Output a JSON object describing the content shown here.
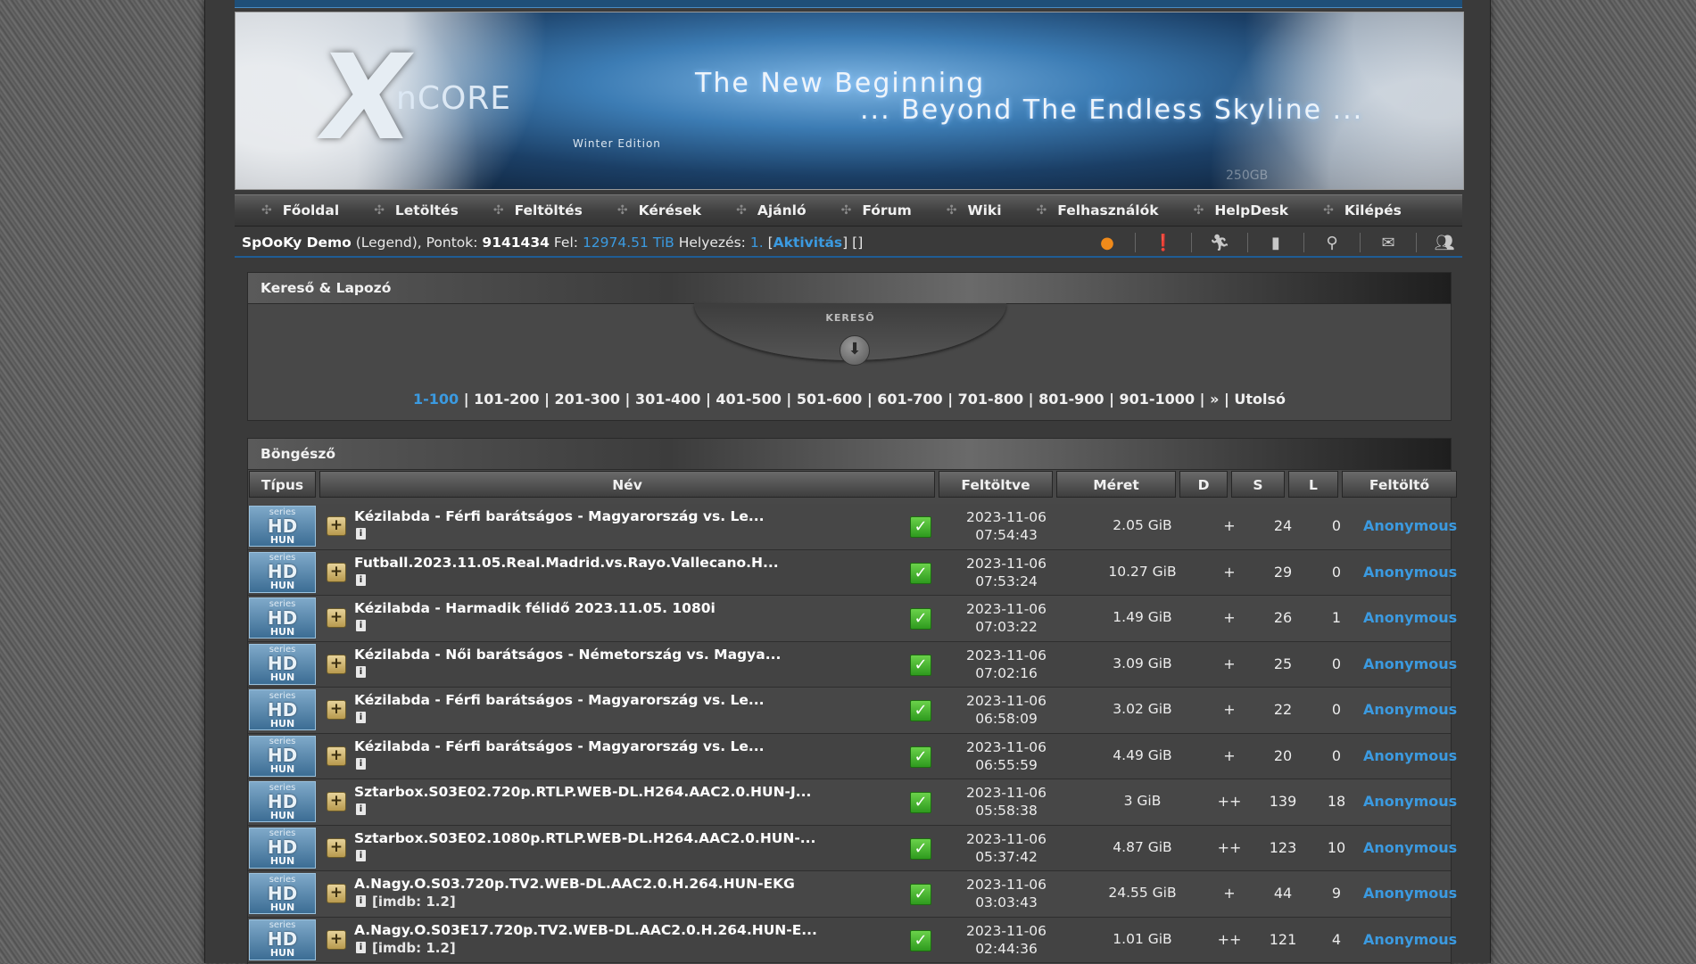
{
  "banner": {
    "logo_x": "X",
    "logo_rest": "nCORE",
    "edition": "Winter Edition",
    "tagline1": "The New Beginning",
    "tagline2": "... Beyond The Endless Skyline ...",
    "watermark": "250GB"
  },
  "nav": [
    {
      "label": "Főoldal"
    },
    {
      "label": "Letöltés"
    },
    {
      "label": "Feltöltés"
    },
    {
      "label": "Kérések"
    },
    {
      "label": "Ajánló"
    },
    {
      "label": "Fórum"
    },
    {
      "label": "Wiki"
    },
    {
      "label": "Felhasználók"
    },
    {
      "label": "HelpDesk"
    },
    {
      "label": "Kilépés"
    }
  ],
  "user": {
    "name": "SpOoKy Demo",
    "rank": "(Legend), Pontok:",
    "points": "9141434",
    "upload_label": "Fel:",
    "upload": "12974.51 TiB",
    "position_label": "Helyezés:",
    "position": "1.",
    "activity_open": "[",
    "activity": "Aktivitás",
    "activity_close": "] []"
  },
  "user_icons": [
    "pumpkin-icon",
    "alert-icon",
    "runner-icon",
    "bookmark-icon",
    "search-icon",
    "message-icon",
    "users-icon"
  ],
  "kereso": {
    "header": "Kereső & Lapozó",
    "tab_label": "KERESŐ",
    "arrow": "⬇"
  },
  "pager": [
    {
      "label": "1-100",
      "current": true
    },
    {
      "label": "101-200"
    },
    {
      "label": "201-300"
    },
    {
      "label": "301-400"
    },
    {
      "label": "401-500"
    },
    {
      "label": "501-600"
    },
    {
      "label": "601-700"
    },
    {
      "label": "701-800"
    },
    {
      "label": "801-900"
    },
    {
      "label": "901-1000"
    },
    {
      "label": "»"
    },
    {
      "label": "Utolsó"
    }
  ],
  "browser": {
    "header": "Böngésző",
    "columns": [
      "Típus",
      "Név",
      "Feltöltve",
      "Méret",
      "D",
      "S",
      "L",
      "Feltöltő"
    ]
  },
  "category_badge": {
    "line1": "series",
    "line2": "HD",
    "line3": "HUN"
  },
  "torrents": [
    {
      "name": "Kézilabda - Férfi barátságos - Magyarország vs. Le...",
      "imdb": "",
      "date": "2023-11-06",
      "time": "07:54:43",
      "size": "2.05 GiB",
      "d": "+",
      "s": "24",
      "l": "0",
      "uploader": "Anonymous"
    },
    {
      "name": "Futball.2023.11.05.Real.Madrid.vs.Rayo.Vallecano.H...",
      "imdb": "",
      "date": "2023-11-06",
      "time": "07:53:24",
      "size": "10.27 GiB",
      "d": "+",
      "s": "29",
      "l": "0",
      "uploader": "Anonymous"
    },
    {
      "name": "Kézilabda - Harmadik félidő 2023.11.05. 1080i",
      "imdb": "",
      "date": "2023-11-06",
      "time": "07:03:22",
      "size": "1.49 GiB",
      "d": "+",
      "s": "26",
      "l": "1",
      "uploader": "Anonymous"
    },
    {
      "name": "Kézilabda - Női barátságos - Németország vs. Magya...",
      "imdb": "",
      "date": "2023-11-06",
      "time": "07:02:16",
      "size": "3.09 GiB",
      "d": "+",
      "s": "25",
      "l": "0",
      "uploader": "Anonymous"
    },
    {
      "name": "Kézilabda - Férfi barátságos - Magyarország vs. Le...",
      "imdb": "",
      "date": "2023-11-06",
      "time": "06:58:09",
      "size": "3.02 GiB",
      "d": "+",
      "s": "22",
      "l": "0",
      "uploader": "Anonymous"
    },
    {
      "name": "Kézilabda - Férfi barátságos - Magyarország vs. Le...",
      "imdb": "",
      "date": "2023-11-06",
      "time": "06:55:59",
      "size": "4.49 GiB",
      "d": "+",
      "s": "20",
      "l": "0",
      "uploader": "Anonymous"
    },
    {
      "name": "Sztarbox.S03E02.720p.RTLP.WEB-DL.H264.AAC2.0.HUN-J...",
      "imdb": "",
      "date": "2023-11-06",
      "time": "05:58:38",
      "size": "3 GiB",
      "d": "++",
      "s": "139",
      "l": "18",
      "uploader": "Anonymous"
    },
    {
      "name": "Sztarbox.S03E02.1080p.RTLP.WEB-DL.H264.AAC2.0.HUN-...",
      "imdb": "",
      "date": "2023-11-06",
      "time": "05:37:42",
      "size": "4.87 GiB",
      "d": "++",
      "s": "123",
      "l": "10",
      "uploader": "Anonymous"
    },
    {
      "name": "A.Nagy.O.S03.720p.TV2.WEB-DL.AAC2.0.H.264.HUN-EKG",
      "imdb": "[imdb: 1.2]",
      "date": "2023-11-06",
      "time": "03:03:43",
      "size": "24.55 GiB",
      "d": "+",
      "s": "44",
      "l": "9",
      "uploader": "Anonymous"
    },
    {
      "name": "A.Nagy.O.S03E17.720p.TV2.WEB-DL.AAC2.0.H.264.HUN-E...",
      "imdb": "[imdb: 1.2]",
      "date": "2023-11-06",
      "time": "02:44:36",
      "size": "1.01 GiB",
      "d": "++",
      "s": "121",
      "l": "4",
      "uploader": "Anonymous"
    }
  ],
  "colors": {
    "link_blue": "#3b9ae0",
    "accent_bar": "#1f5d94"
  }
}
